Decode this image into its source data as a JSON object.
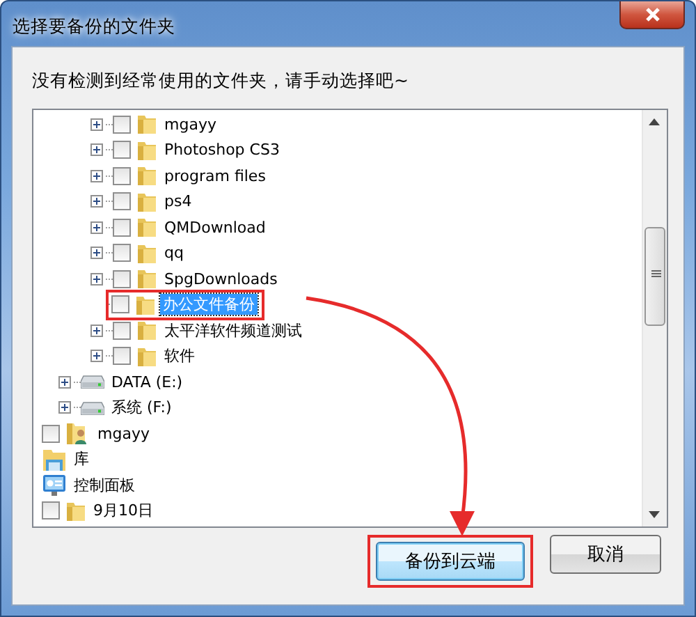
{
  "window": {
    "title": "选择要备份的文件夹"
  },
  "message": "没有检测到经常使用的文件夹，请手动选择吧~",
  "tree": {
    "items": [
      {
        "children": [
          {
            "children": [
              {
                "label": "mgayy",
                "kind": "folder",
                "expandable": true,
                "checked": false,
                "selected": false,
                "highlighted": false
              },
              {
                "label": "Photoshop CS3",
                "kind": "folder",
                "expandable": true,
                "checked": false,
                "selected": false,
                "highlighted": false
              },
              {
                "label": "program files",
                "kind": "folder",
                "expandable": true,
                "checked": false,
                "selected": false,
                "highlighted": false
              },
              {
                "label": "ps4",
                "kind": "folder",
                "expandable": true,
                "checked": false,
                "selected": false,
                "highlighted": false
              },
              {
                "label": "QMDownload",
                "kind": "folder",
                "expandable": true,
                "checked": false,
                "selected": false,
                "highlighted": false
              },
              {
                "label": "qq",
                "kind": "folder",
                "expandable": true,
                "checked": false,
                "selected": false,
                "highlighted": false
              },
              {
                "label": "SpgDownloads",
                "kind": "folder",
                "expandable": true,
                "checked": false,
                "selected": false,
                "highlighted": false
              },
              {
                "label": "办公文件备份",
                "kind": "folder",
                "expandable": false,
                "checked": false,
                "selected": true,
                "highlighted": true
              },
              {
                "label": "太平洋软件频道测试",
                "kind": "folder",
                "expandable": true,
                "checked": false,
                "selected": false,
                "highlighted": false
              },
              {
                "label": "软件",
                "kind": "folder",
                "expandable": true,
                "checked": false,
                "selected": false,
                "highlighted": false
              }
            ]
          },
          {
            "label": "DATA (E:)",
            "kind": "drive",
            "expandable": true,
            "selected": false,
            "highlighted": false
          },
          {
            "label": "系统 (F:)",
            "kind": "drive",
            "expandable": true,
            "selected": false,
            "highlighted": false
          }
        ]
      },
      {
        "label": "mgayy",
        "kind": "user",
        "checked": false,
        "selected": false,
        "highlighted": false
      },
      {
        "label": "库",
        "kind": "library",
        "selected": false,
        "highlighted": false
      },
      {
        "label": "控制面板",
        "kind": "control-panel",
        "selected": false,
        "highlighted": false
      },
      {
        "label": "9月10日",
        "kind": "folder",
        "checked": false,
        "selected": false,
        "highlighted": false
      }
    ]
  },
  "buttons": [
    {
      "label": "备份到云端",
      "default": true,
      "highlighted": true
    },
    {
      "label": "取消",
      "default": false,
      "highlighted": false
    }
  ],
  "annotation": {
    "arrow": true
  }
}
